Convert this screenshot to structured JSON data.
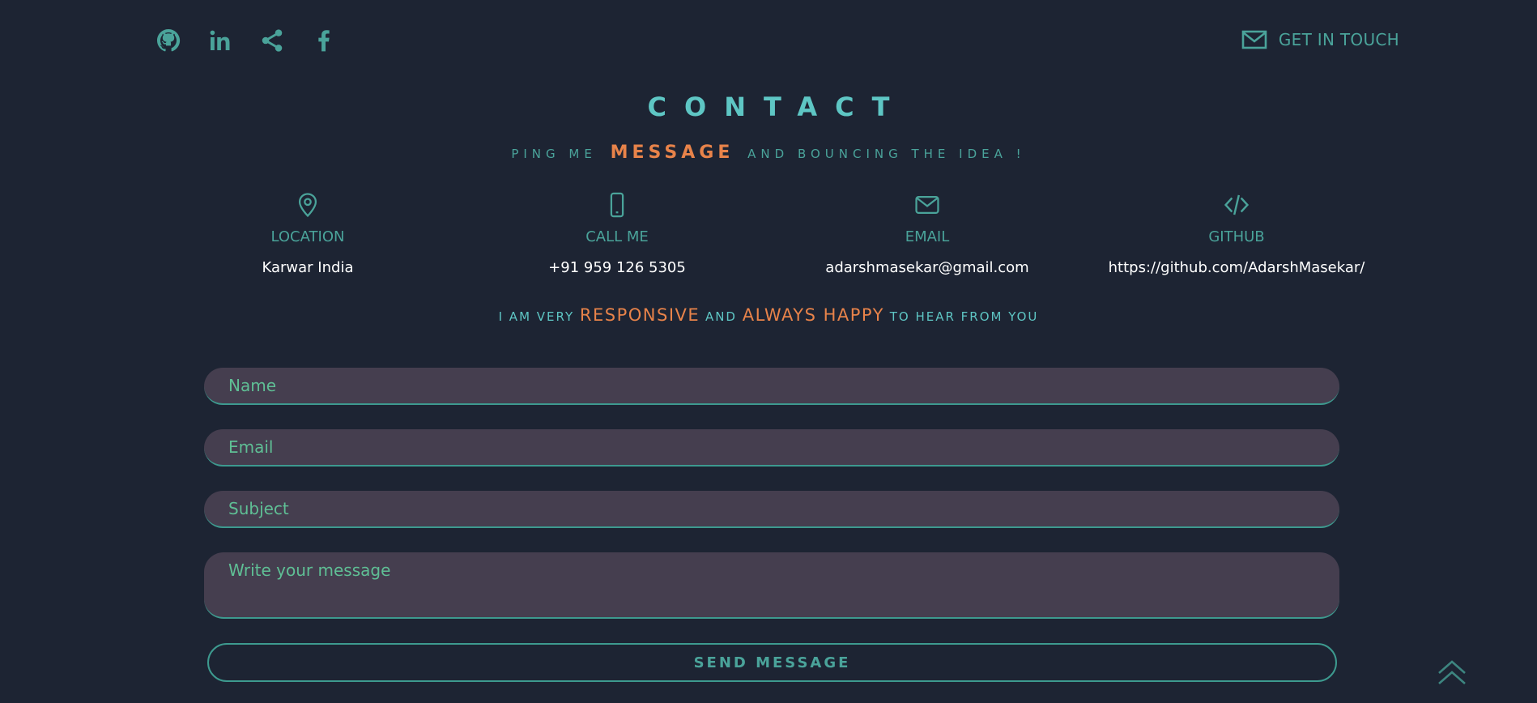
{
  "header": {
    "social": [
      {
        "icon": "github-icon"
      },
      {
        "icon": "linkedin-icon"
      },
      {
        "icon": "share-icon"
      },
      {
        "icon": "facebook-icon"
      }
    ],
    "get_in_touch": "GET IN TOUCH"
  },
  "contact": {
    "title": "CONTACT",
    "subtitle_pre": "PING ME",
    "subtitle_highlight": "MESSAGE",
    "subtitle_post": "AND BOUNCING THE IDEA !"
  },
  "info": [
    {
      "icon": "location-icon",
      "label": "LOCATION",
      "value": "Karwar India"
    },
    {
      "icon": "phone-icon",
      "label": "CALL ME",
      "value": "+91 959 126 5305"
    },
    {
      "icon": "mail-icon",
      "label": "EMAIL",
      "value": "adarshmasekar@gmail.com"
    },
    {
      "icon": "code-icon",
      "label": "GITHUB",
      "value": "https://github.com/AdarshMasekar/"
    }
  ],
  "tagline": {
    "part1": "I AM VERY",
    "hl1": "RESPONSIVE",
    "part2": "AND",
    "hl2": "ALWAYS HAPPY",
    "part3": "TO HEAR FROM YOU"
  },
  "form": {
    "name_placeholder": "Name",
    "email_placeholder": "Email",
    "subject_placeholder": "Subject",
    "message_placeholder": "Write your message",
    "send_label": "SEND MESSAGE"
  },
  "colors": {
    "background": "#1d2433",
    "accent": "#4aa39a",
    "highlight": "#e8834a",
    "field_bg": "#453e4f"
  },
  "scroll_top_icon": "chevron-double-up-icon"
}
